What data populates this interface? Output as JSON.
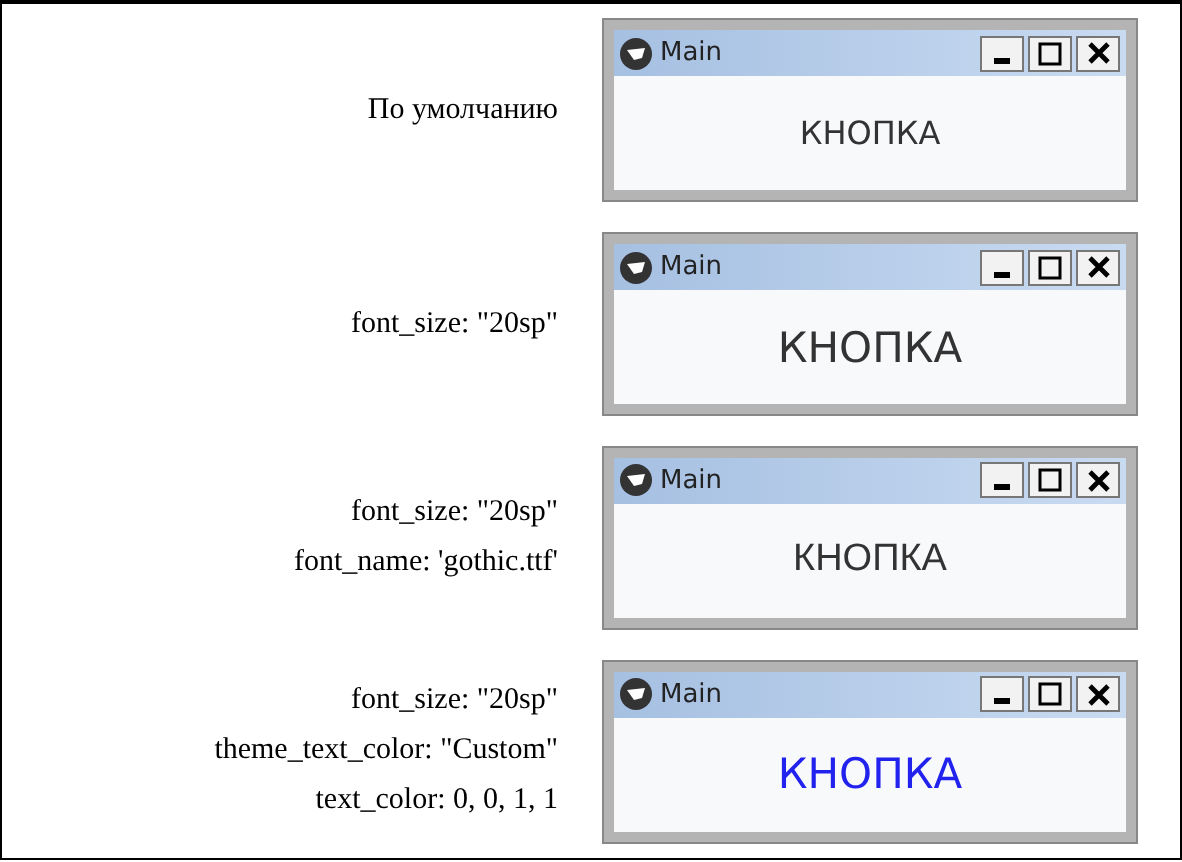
{
  "rows": [
    {
      "labels": [
        "По умолчанию"
      ],
      "window": {
        "title": "Main",
        "kind": "default",
        "button": "КНОПКА",
        "color": "#333333"
      }
    },
    {
      "labels": [
        "font_size: \"20sp\""
      ],
      "window": {
        "title": "Main",
        "kind": "large",
        "button": "КНОПКА",
        "color": "#333333"
      }
    },
    {
      "labels": [
        "font_size: \"20sp\"",
        "font_name: 'gothic.ttf'"
      ],
      "window": {
        "title": "Main",
        "kind": "gothic",
        "button": "КНОПКА",
        "color": "#333333"
      }
    },
    {
      "labels": [
        "font_size: \"20sp\"",
        "theme_text_color: \"Custom\"",
        "text_color: 0, 0, 1, 1"
      ],
      "window": {
        "title": "Main",
        "kind": "large",
        "button": "КНОПКА",
        "color": "#2222ee"
      }
    }
  ]
}
